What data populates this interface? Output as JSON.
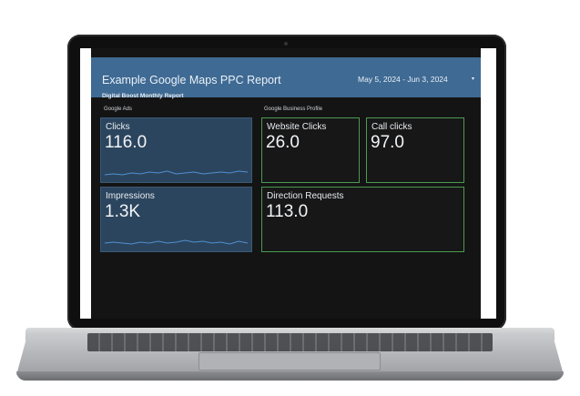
{
  "report": {
    "title": "Example Google Maps PPC Report",
    "subtitle": "Digital Boost Monthly Report",
    "date_range": "May 5, 2024 - Jun 3, 2024",
    "date_caret": "▾"
  },
  "sections": {
    "google_ads": "Google Ads",
    "google_business_profile": "Google Business Profile"
  },
  "metrics": {
    "clicks": {
      "label": "Clicks",
      "value": "116.0"
    },
    "impressions": {
      "label": "Impressions",
      "value": "1.3K"
    },
    "website_clicks": {
      "label": "Website Clicks",
      "value": "26.0"
    },
    "call_clicks": {
      "label": "Call clicks",
      "value": "97.0"
    },
    "direction_requests": {
      "label": "Direction Requests",
      "value": "113.0"
    }
  },
  "colors": {
    "header": "#3f6a93",
    "ads_card": "#2c455e",
    "gbp_border": "#4a9b51",
    "sparkline": "#4f8fd0"
  }
}
